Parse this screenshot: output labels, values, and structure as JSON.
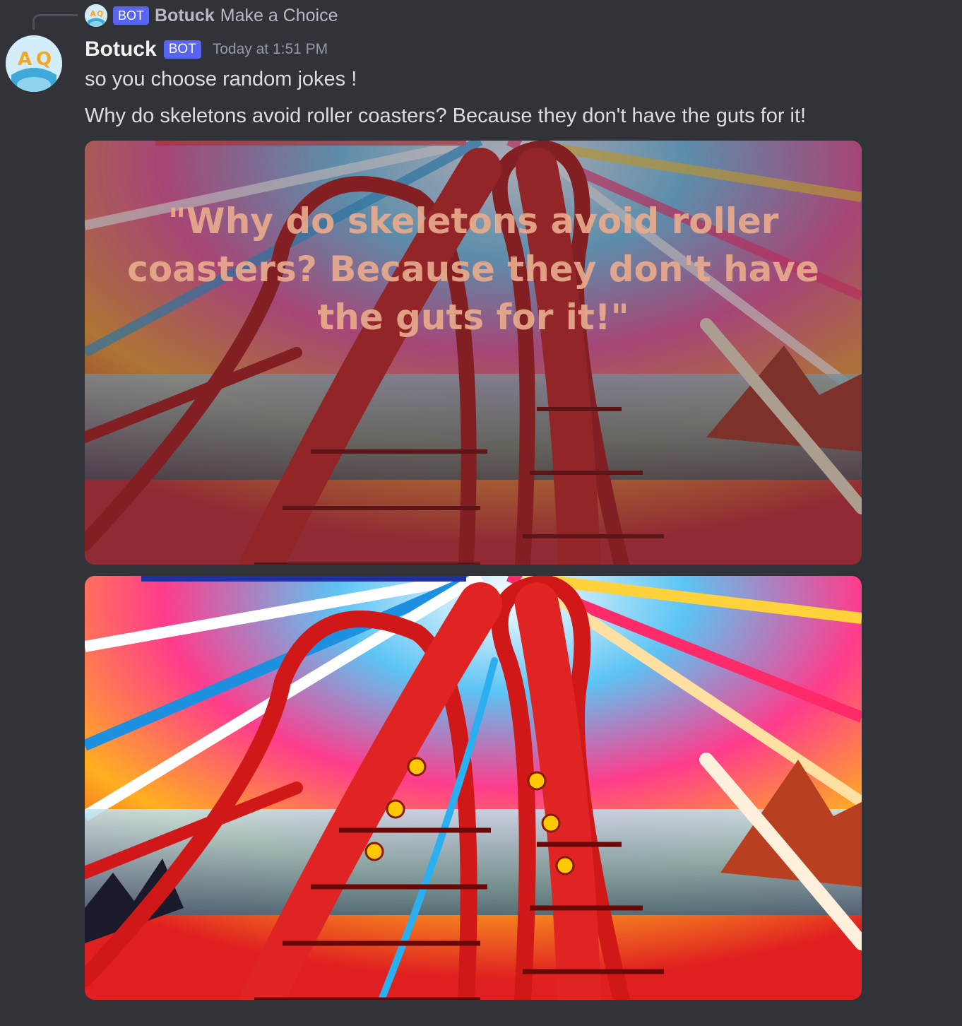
{
  "reply": {
    "bot_tag": "BOT",
    "author": "Botuck",
    "content": "Make a Choice",
    "avatar_icon": "bot-avatar-icon"
  },
  "message": {
    "author": "Botuck",
    "bot_tag": "BOT",
    "timestamp": "Today at 1:51 PM",
    "lines": [
      "so you choose random jokes !",
      "Why do skeletons avoid roller coasters? Because they don't have the guts for it!"
    ],
    "avatar_icon": "bot-avatar-icon"
  },
  "attachments": [
    {
      "type": "roller-coaster-image-with-text",
      "overlay_text": "\"Why do skeletons avoid roller coasters? Because they don't have the guts for it!\""
    },
    {
      "type": "roller-coaster-image"
    }
  ],
  "colors": {
    "background": "#313338",
    "bot_tag": "#5865f2",
    "author": "#f2f3f5",
    "text": "#dbdee1",
    "muted": "#949ba4"
  }
}
